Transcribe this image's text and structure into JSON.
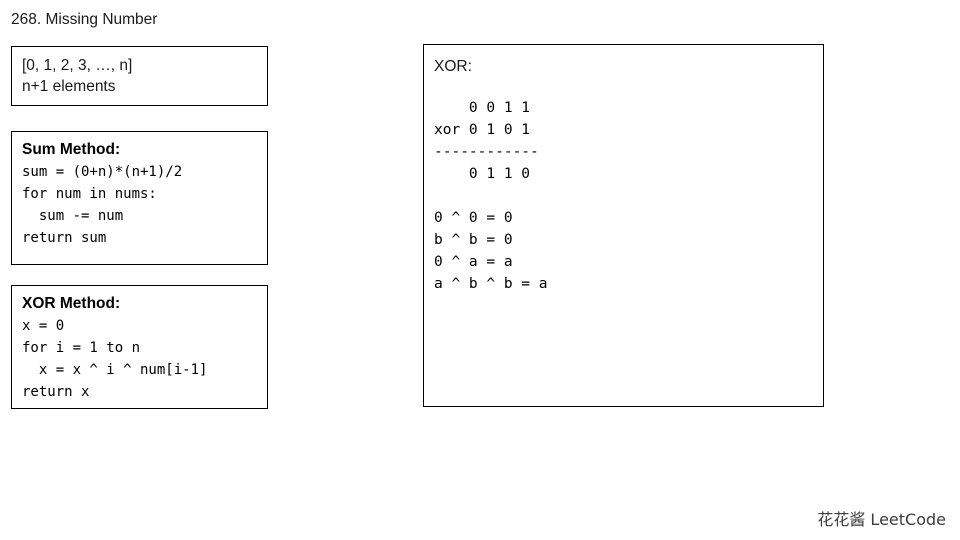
{
  "slide": {
    "title": "268. Missing Number",
    "background_color": "#ffffff",
    "text_color": "#000000"
  },
  "array_box": {
    "lines": [
      "[0, 1, 2, 3, …, n]",
      "n+1 elements"
    ]
  },
  "sum_box": {
    "heading": "Sum Method:",
    "code": [
      "sum = (0+n)*(n+1)/2",
      "for num in nums:",
      "  sum -= num",
      "return sum"
    ]
  },
  "xor_method_box": {
    "heading": "XOR Method:",
    "code": [
      "x = 0",
      "for i = 1 to n",
      "  x = x ^ i ^ num[i-1]",
      "return x"
    ]
  },
  "xor_panel": {
    "heading": "XOR:",
    "truth_table": [
      "    0 0 1 1",
      "xor 0 1 0 1",
      "------------",
      "    0 1 1 0"
    ],
    "identities": [
      "0 ^ 0 = 0",
      "b ^ b = 0",
      "0 ^ a = a",
      "a ^ b ^ b = a"
    ]
  },
  "watermark": {
    "text": "花花酱 LeetCode"
  }
}
